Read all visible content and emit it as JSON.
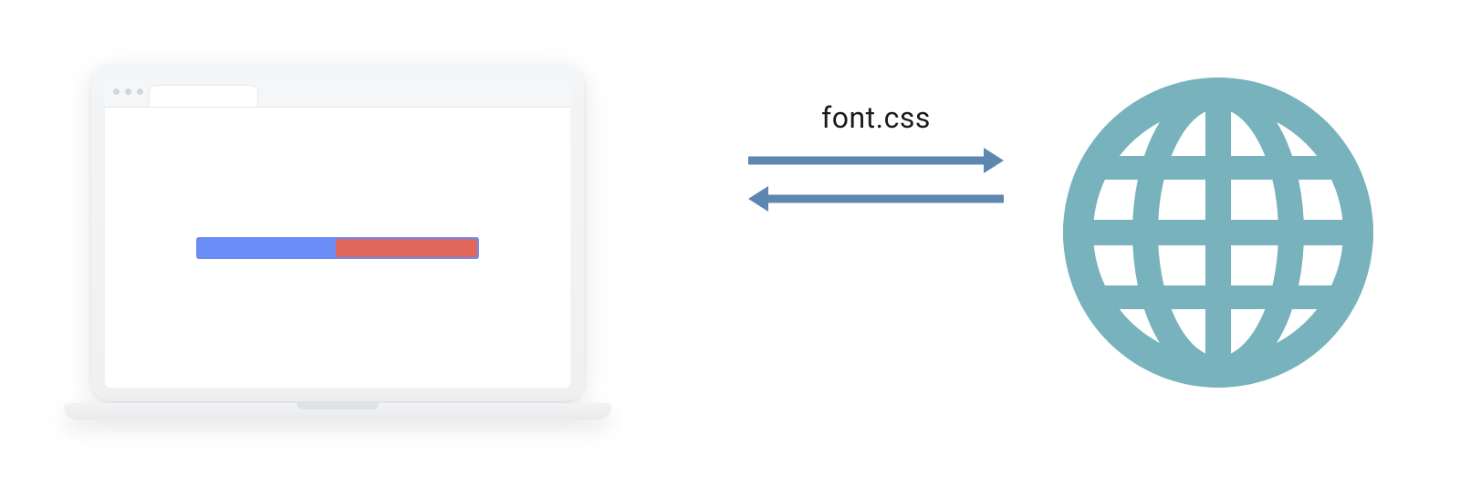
{
  "diagram": {
    "label": "font.css",
    "colors": {
      "arrow": "#5d86b0",
      "globe": "#77b2bd",
      "bar_bg": "#6a8cf7",
      "bar_fill": "#e1675a"
    },
    "bar": {
      "fill_percent_from_right": 50
    },
    "icons": {
      "laptop": "laptop-browser-icon",
      "globe": "globe-icon",
      "arrow_right": "arrow-right-icon",
      "arrow_left": "arrow-left-icon"
    }
  }
}
